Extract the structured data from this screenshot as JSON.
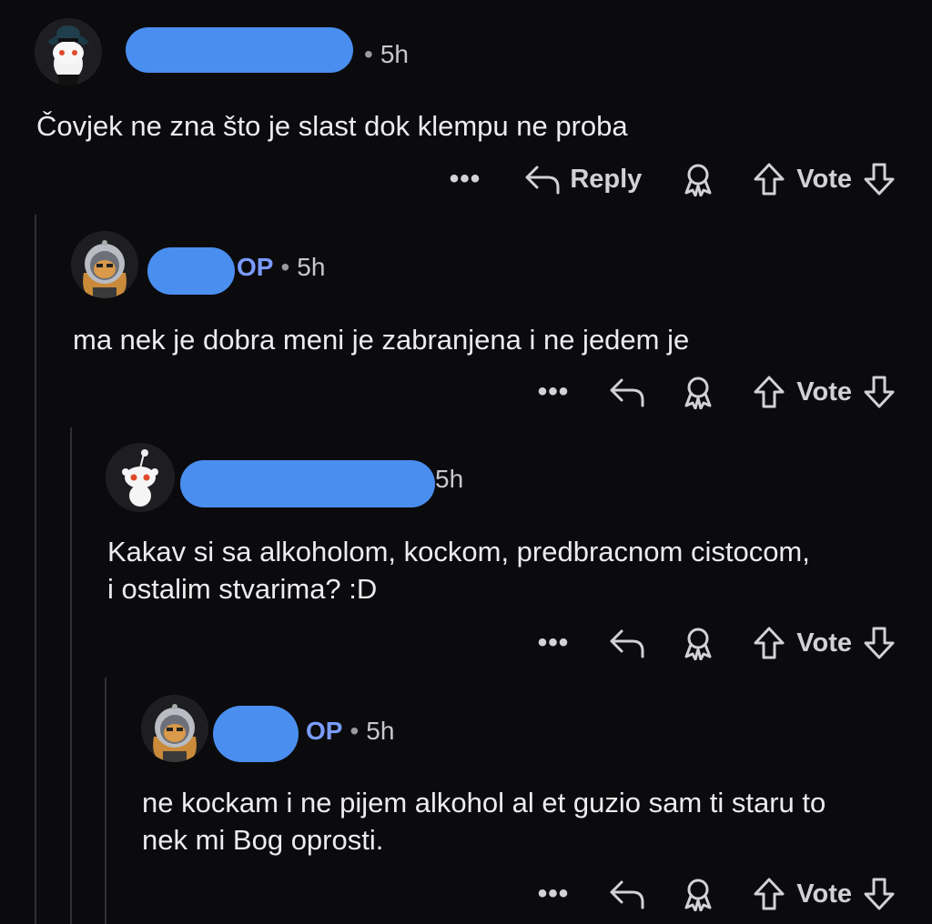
{
  "comments": [
    {
      "username": "",
      "is_op": false,
      "op_label": "",
      "time": "5h",
      "text": "Čovjek ne zna što je slast dok klempu ne proba",
      "reply_label": "Reply",
      "vote_label": "Vote",
      "more_label": "•••",
      "avatar": "snoo-hat-avatar"
    },
    {
      "username": "",
      "is_op": true,
      "op_label": "OP",
      "time": "5h",
      "text": "ma nek je dobra meni je zabranjena i ne jedem je",
      "reply_label": "",
      "vote_label": "Vote",
      "more_label": "•••",
      "avatar": "astronaut-avatar"
    },
    {
      "username": "",
      "is_op": false,
      "op_label": "",
      "time": "5h",
      "text": "Kakav si sa alkoholom, kockom, predbracnom cistocom, i ostalim stvarima? :D",
      "reply_label": "",
      "vote_label": "Vote",
      "more_label": "•••",
      "avatar": "snoo-default-avatar"
    },
    {
      "username": "",
      "is_op": true,
      "op_label": "OP",
      "time": "5h",
      "text": "ne kockam i ne pijem alkohol al et guzio sam ti staru to nek mi Bog oprosti.",
      "reply_label": "",
      "vote_label": "Vote",
      "more_label": "•••",
      "avatar": "astronaut-avatar"
    }
  ],
  "colors": {
    "background": "#0b0b0d",
    "op": "#7a9cff",
    "redaction": "#4a8ef0"
  }
}
